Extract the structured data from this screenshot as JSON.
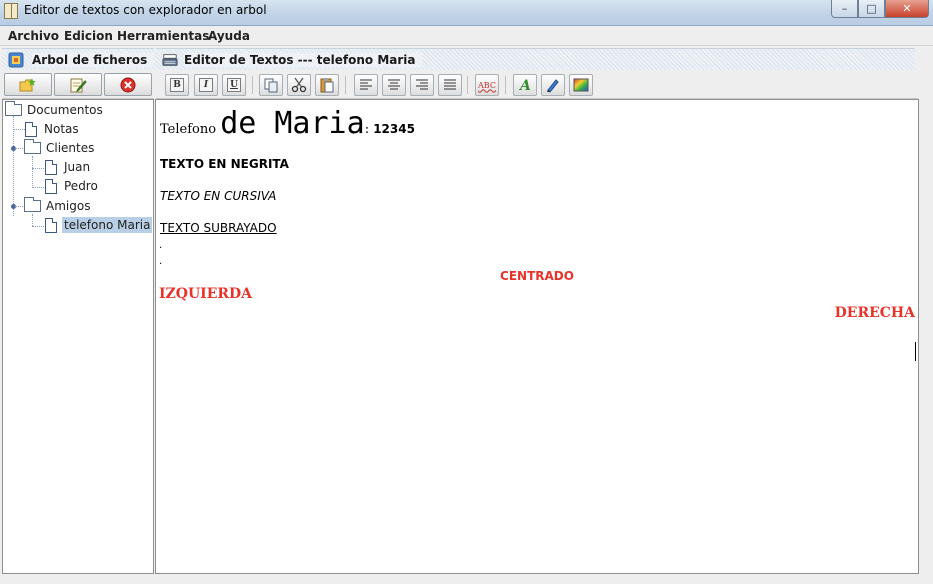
{
  "window": {
    "title": "Editor de textos con explorador en arbol",
    "controls": {
      "minimize": "–",
      "maximize": "□",
      "close": "✕"
    }
  },
  "menu": {
    "items": [
      "Archivo",
      "Edicion",
      "Herramientas",
      "Ayuda"
    ]
  },
  "left_panel": {
    "header": "Arbol de ficheros",
    "toolbar": {
      "icons": [
        "new-folder-icon",
        "edit-icon",
        "delete-icon"
      ]
    },
    "tree": {
      "root": "Documentos",
      "items": [
        {
          "label": "Notas",
          "type": "document"
        },
        {
          "label": "Clientes",
          "type": "folder",
          "children": [
            "Juan",
            "Pedro"
          ]
        },
        {
          "label": "Amigos",
          "type": "folder",
          "children": [
            "telefono Maria"
          ]
        }
      ],
      "selected": "telefono Maria"
    }
  },
  "right_panel": {
    "header": "Editor de Textos  ---  telefono Maria",
    "toolbar": {
      "bold": "B",
      "italic": "I",
      "underline": "U",
      "spell": "ABC",
      "icons": [
        "copy-icon",
        "cut-icon",
        "paste-icon",
        "align-left-icon",
        "align-center-icon",
        "align-right-icon",
        "align-justify-icon",
        "spellcheck-icon",
        "font-color-icon",
        "highlight-icon",
        "color-palette-icon"
      ]
    },
    "document": {
      "line1": {
        "a": "Telefono ",
        "b": "de Maria",
        "c": ": ",
        "d": "12345"
      },
      "bold": "TEXTO EN NEGRITA",
      "italic": "TEXTO EN CURSIVA",
      "underline": "TEXTO SUBRAYADO",
      "dot1": ".",
      "dot2": ".",
      "center": "CENTRADO",
      "left": "IZQUIERDA",
      "right": "DERECHA",
      "accent_color": "#e8332b"
    }
  }
}
